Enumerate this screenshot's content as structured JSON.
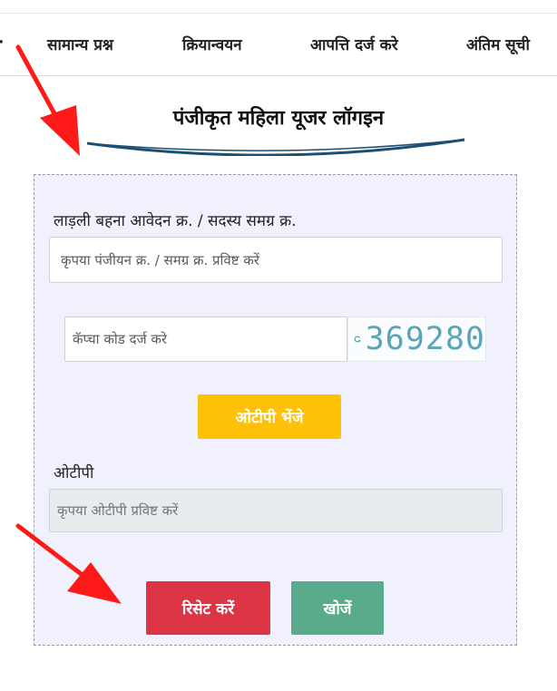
{
  "nav": {
    "items": [
      {
        "label": "सामान्य प्रश्न"
      },
      {
        "label": "क्रियान्वयन"
      },
      {
        "label": "आपत्ति दर्ज करे"
      },
      {
        "label": "अंतिम सूची"
      }
    ]
  },
  "page": {
    "title": "पंजीकृत महिला यूजर लॉगइन"
  },
  "form": {
    "application_label": "लाड़ली बहना आवेदन क्र. / सदस्य समग्र क्र.",
    "application_placeholder": "कृपया पंजीयन क्र. / समग्र क्र. प्रविष्ट करें",
    "captcha_placeholder": "कॅप्चा कोड दर्ज करे",
    "captcha_code": "369280",
    "send_otp_label": "ओटीपी भेंजे",
    "otp_label": "ओटीपी",
    "otp_placeholder": "कृपया ओटीपी प्रविष्ट करें",
    "reset_label": "रिसेट करें",
    "search_label": "खोजें"
  },
  "icons": {
    "captcha_refresh": "refresh-icon",
    "annotation_arrow": "red-arrow-icon"
  },
  "colors": {
    "card_bg": "#f1f1fd",
    "otp_button": "#fec107",
    "reset_button": "#dc3545",
    "search_button": "#5aab8b",
    "arrow": "#ff1a1a",
    "title_curve": "#1d4f73"
  }
}
